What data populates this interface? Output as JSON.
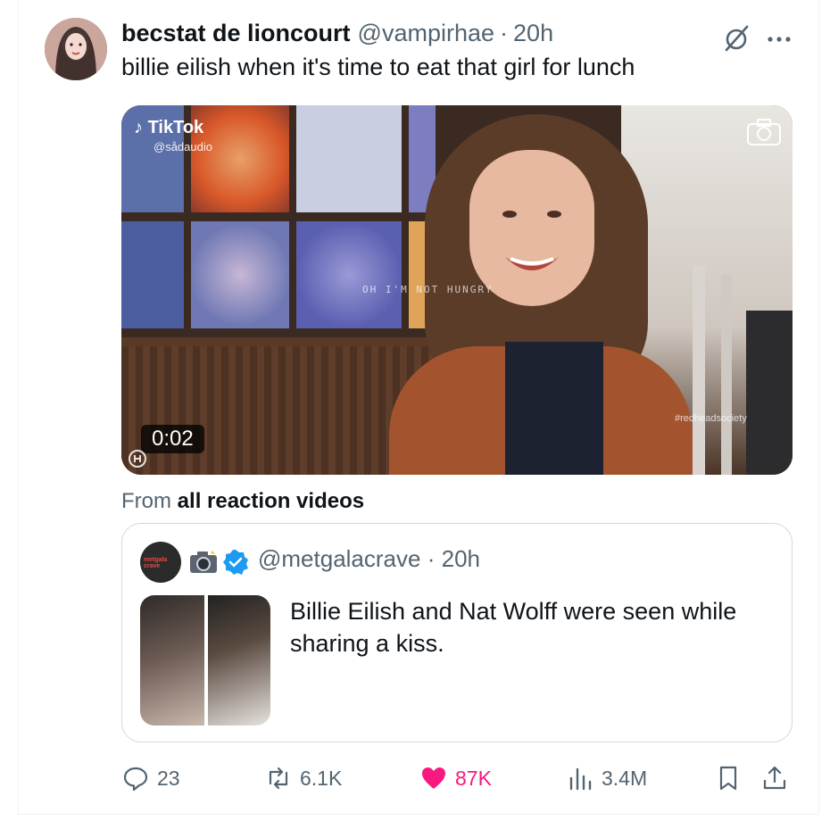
{
  "tweet": {
    "display_name": "becstat de lioncourt",
    "handle": "@vampirhae",
    "separator": "·",
    "time": "20h",
    "text": "billie eilish when it's time to eat that girl for lunch"
  },
  "media": {
    "tiktok_label": "TikTok",
    "tiktok_user": "@sådaudio",
    "caption_overlay": "OH I'M NOT HUNGRY",
    "watermark": "#redheadsociety",
    "duration": "0:02"
  },
  "source": {
    "prefix": "From",
    "name": "all reaction videos"
  },
  "quote": {
    "handle": "@metgalacrave",
    "separator": "·",
    "time": "20h",
    "text": "Billie Eilish and Nat Wolff were seen while sharing a kiss.",
    "avatar_text": "metgala crave"
  },
  "actions": {
    "replies": "23",
    "reposts": "6.1K",
    "likes": "87K",
    "views": "3.4M"
  },
  "colors": {
    "like": "#f91880",
    "verified": "#1d9bf0",
    "muted": "#536471"
  }
}
